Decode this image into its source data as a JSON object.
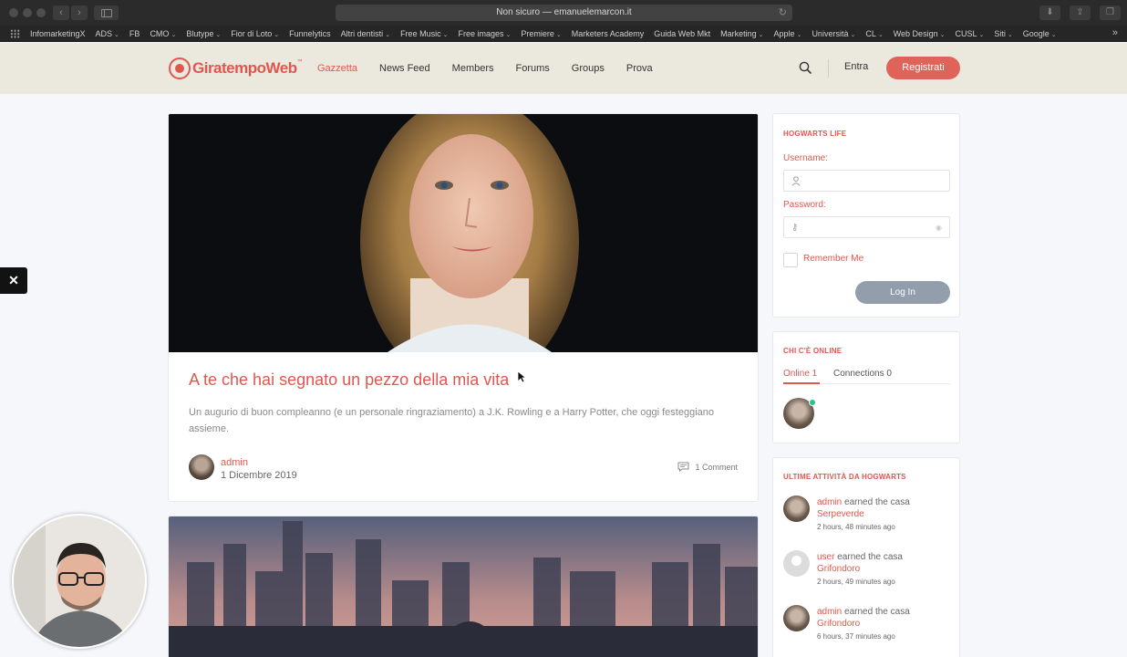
{
  "browser": {
    "url": "Non sicuro — emanuelemarcon.it",
    "bookmarks": [
      {
        "label": "InfomarketingX",
        "caret": false
      },
      {
        "label": "ADS",
        "caret": true
      },
      {
        "label": "FB",
        "caret": false
      },
      {
        "label": "CMO",
        "caret": true
      },
      {
        "label": "Blutype",
        "caret": true
      },
      {
        "label": "Fior di Loto",
        "caret": true
      },
      {
        "label": "Funnelytics",
        "caret": false
      },
      {
        "label": "Altri dentisti",
        "caret": true
      },
      {
        "label": "Free Music",
        "caret": true
      },
      {
        "label": "Free images",
        "caret": true
      },
      {
        "label": "Premiere",
        "caret": true
      },
      {
        "label": "Marketers Academy",
        "caret": false
      },
      {
        "label": "Guida Web Mkt",
        "caret": false
      },
      {
        "label": "Marketing",
        "caret": true
      },
      {
        "label": "Apple",
        "caret": true
      },
      {
        "label": "Università",
        "caret": true
      },
      {
        "label": "CL",
        "caret": true
      },
      {
        "label": "Web Design",
        "caret": true
      },
      {
        "label": "CUSL",
        "caret": true
      },
      {
        "label": "Siti",
        "caret": true
      },
      {
        "label": "Google",
        "caret": true
      }
    ]
  },
  "site": {
    "logo_text": "GiratempoWeb",
    "logo_tm": "™",
    "nav": [
      "Gazzetta",
      "News Feed",
      "Members",
      "Forums",
      "Groups",
      "Prova"
    ],
    "active_nav": "Gazzetta",
    "login_label": "Entra",
    "register_label": "Registrati",
    "accent_color": "#e0574f"
  },
  "posts": [
    {
      "title": "A te che hai segnato un pezzo della mia vita",
      "excerpt": "Un augurio di buon compleanno (e un personale ringraziamento) a J.K. Rowling e a Harry Potter, che oggi festeggiano assieme.",
      "author": "admin",
      "date": "1 Dicembre 2019",
      "comments": "1 Comment"
    }
  ],
  "sidebar": {
    "login_widget": {
      "title": "HOGWARTS LIFE",
      "username_label": "Username:",
      "password_label": "Password:",
      "remember_label": "Remember Me",
      "login_button": "Log In"
    },
    "online_widget": {
      "title": "CHI C'È ONLINE",
      "tab_online": "Online 1",
      "tab_connections": "Connections 0"
    },
    "activity_widget": {
      "title": "ULTIME ATTIVITÀ DA HOGWARTS",
      "items": [
        {
          "user": "admin",
          "action": "earned the casa",
          "house": "Serpeverde",
          "time": "2 hours, 48 minutes ago"
        },
        {
          "user": "user",
          "action": "earned the casa",
          "house": "Grifondoro",
          "time": "2 hours, 49 minutes ago"
        },
        {
          "user": "admin",
          "action": "earned the casa",
          "house": "Grifondoro",
          "time": "6 hours, 37 minutes ago"
        }
      ]
    }
  }
}
